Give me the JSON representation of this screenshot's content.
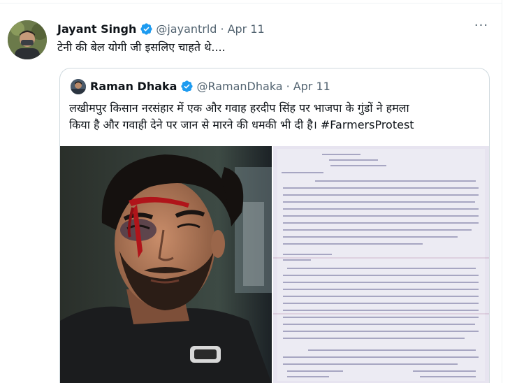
{
  "tweet": {
    "author_name": "Jayant Singh",
    "handle": "@jayantrld",
    "separator": "·",
    "date": "Apr 11",
    "more_label": "···",
    "text": "टेनी की बेल योगी जी इसलिए चाहते थे...."
  },
  "quoted_tweet": {
    "author_name": "Raman Dhaka",
    "handle": "@RamanDhaka",
    "separator": "·",
    "date": "Apr 11",
    "text_line1": "लखीमपुर किसान नरसंहार में एक और गवाह हरदीप सिंह पर भाजपा के गुंडों ने हमला",
    "text_line2": "किया है और गवाही देने पर जान से मारने की धमकी भी दी है। #FarmersProtest"
  },
  "colors": {
    "verified": "#1d9bf0",
    "muted": "#536471",
    "border": "#cfd9de",
    "text": "#0f1419"
  },
  "icons": {
    "verified": "verified-badge-icon",
    "more": "more-options-icon"
  }
}
